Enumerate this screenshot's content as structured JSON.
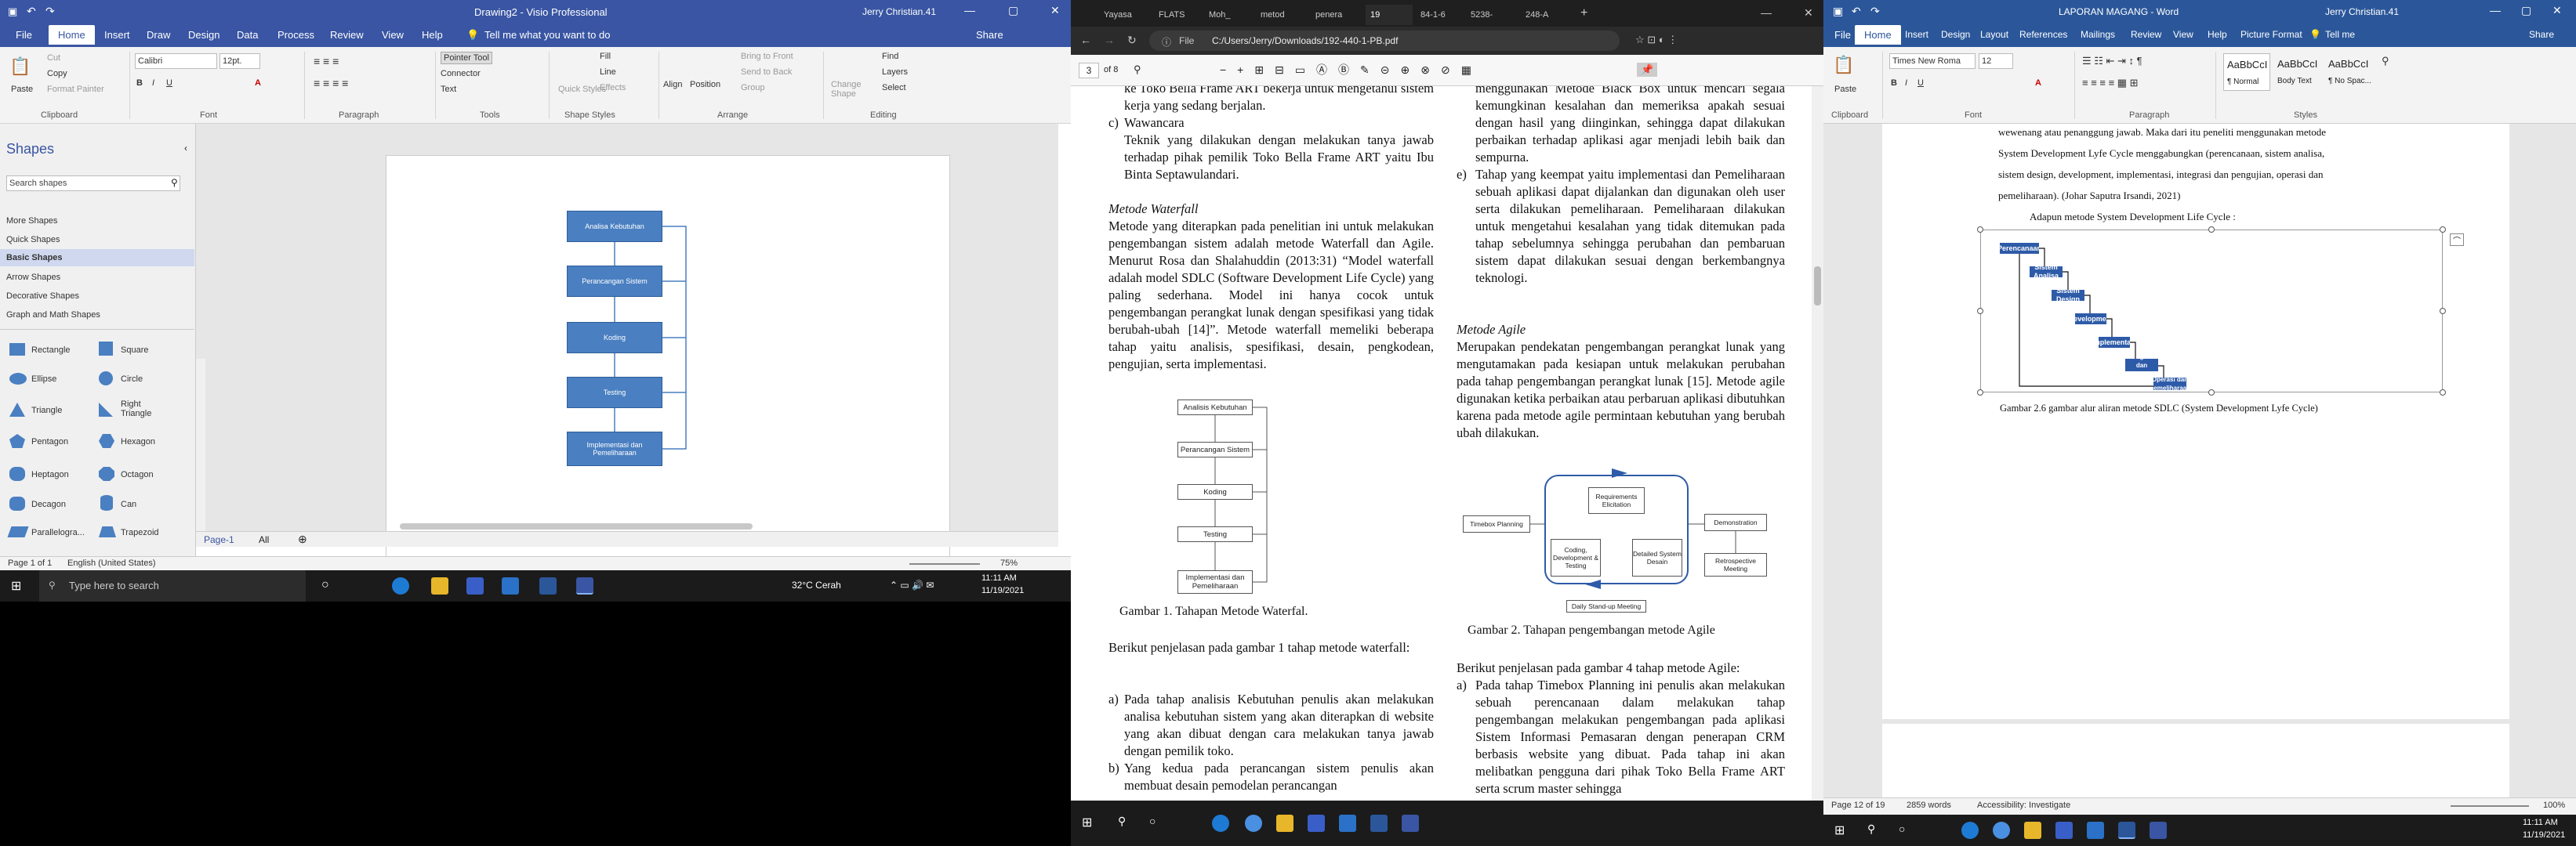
{
  "visio": {
    "title": "Drawing2 - Visio Professional",
    "user": "Jerry Christian.41",
    "tabs": [
      "File",
      "Home",
      "Insert",
      "Draw",
      "Design",
      "Data",
      "Process",
      "Review",
      "View",
      "Help"
    ],
    "tellme": "Tell me what you want to do",
    "share": "Share",
    "ribbon": {
      "clipboard": {
        "paste": "Paste",
        "cut": "Cut",
        "copy": "Copy",
        "format_painter": "Format Painter",
        "label": "Clipboard"
      },
      "font": {
        "name": "Calibri",
        "size": "12pt.",
        "label": "Font"
      },
      "paragraph": {
        "label": "Paragraph"
      },
      "tools": {
        "pointer": "Pointer Tool",
        "connector": "Connector",
        "text": "Text",
        "label": "Tools"
      },
      "shape_styles": {
        "quick": "Quick Styles",
        "fill": "Fill",
        "line": "Line",
        "effects": "Effects",
        "label": "Shape Styles"
      },
      "arrange": {
        "align": "Align",
        "position": "Position",
        "front": "Bring to Front",
        "back": "Send to Back",
        "group": "Group",
        "change": "Change Shape",
        "label": "Arrange"
      },
      "editing": {
        "find": "Find",
        "layers": "Layers",
        "select": "Select",
        "label": "Editing"
      }
    },
    "shapes_panel": {
      "title": "Shapes",
      "search_placeholder": "Search shapes",
      "categories": [
        "More Shapes",
        "Quick Shapes",
        "Basic Shapes",
        "Arrow Shapes",
        "Decorative Shapes",
        "Graph and Math Shapes"
      ],
      "items": [
        "Rectangle",
        "Square",
        "Ellipse",
        "Circle",
        "Triangle",
        "Right Triangle",
        "Pentagon",
        "Hexagon",
        "Heptagon",
        "Octagon",
        "Decagon",
        "Can",
        "Parallelogra...",
        "Trapezoid"
      ]
    },
    "diagram": [
      "Analisa Kebutuhan",
      "Perancangan Sistem",
      "Koding",
      "Testing",
      "Implementasi dan Pemeliharaan"
    ],
    "page_tab": "Page-1",
    "all_tab": "All",
    "status": {
      "page": "Page 1 of 1",
      "language": "English (United States)",
      "zoom": "75%"
    },
    "taskbar": {
      "search": "Type here to search",
      "weather": "32°C  Cerah",
      "time": "11:11 AM",
      "date": "11/19/2021"
    }
  },
  "pdf": {
    "tabs": [
      "Yayasa",
      "FLATS",
      "Moh_",
      "metod",
      "penera",
      "19",
      "84-1-6",
      "5238-",
      "248-A"
    ],
    "address": "C:/Users/Jerry/Downloads/192-440-1-PB.pdf",
    "file_label": "File",
    "page_num": "3",
    "page_of": "of 8",
    "left_col": {
      "p0": "ke Toko Bella Frame ART bekerja untuk mengetahui sistem kerja yang sedang berjalan.",
      "c_label": "c)",
      "c_title": "Wawancara",
      "c_text": "Teknik yang dilakukan dengan melakukan tanya jawab terhadap pihak pemilik Toko Bella Frame ART yaitu Ibu Binta Septawulandari.",
      "h1": "Metode Waterfall",
      "p1": "Metode yang diterapkan pada penelitian ini untuk melakukan pengembangan sistem adalah metode Waterfall dan Agile. Menurut Rosa dan Shalahuddin (2013:31) “Model waterfall adalah model SDLC (Software Development Life Cycle) yang paling sederhana. Model ini hanya cocok untuk pengembangan perangkat lunak dengan spesifikasi yang tidak berubah-ubah [14]”. Metode waterfall memeliki beberapa tahap yaitu analisis, spesifikasi, desain, pengkodean, pengujian, serta implementasi.",
      "fig1_boxes": [
        "Analisis Kebutuhan",
        "Perancangan Sistem",
        "Koding",
        "Testing",
        "Implementasi dan Pemeliharaan"
      ],
      "fig1_caption": "Gambar 1. Tahapan Metode Waterfal.",
      "p2": "Berikut penjelasan pada gambar 1 tahap metode waterfall:",
      "a_label": "a)",
      "a_text": "Pada tahap analisis Kebutuhan penulis akan melakukan analisa kebutuhan sistem yang akan diterapkan di website yang akan dibuat dengan cara melakukan tanya jawab dengan pemilik toko.",
      "b_label": "b)",
      "b_text": "Yang kedua pada perancangan sistem penulis akan membuat desain pemodelan perancangan"
    },
    "right_col": {
      "p0": "menggunakan Metode Black Box untuk mencari segala kemungkinan kesalahan dan memeriksa apakah sesuai dengan hasil yang diinginkan, sehingga dapat dilakukan perbaikan terhadap aplikasi agar menjadi lebih baik dan sempurna.",
      "e_label": "e)",
      "e_text": "Tahap yang keempat yaitu implementasi dan Pemeliharaan sebuah aplikasi dapat dijalankan dan digunakan oleh user serta dilakukan pemeliharaan. Pemeliharaan dilakukan untuk mengetahui kesalahan yang tidak ditemukan pada tahap sebelumnya sehingga perubahan dan pembaruan sistem dapat dilakukan sesuai dengan berkembangnya teknologi.",
      "h1": "Metode Agile",
      "p1": "Merupakan pendekatan pengembangan perangkat lunak yang mengutamakan pada kesiapan untuk melakukan perubahan pada tahap pengembangan perangkat lunak [15]. Metode agile digunakan ketika perbaikan atau perbaruan aplikasi dibutuhkan karena pada metode agile permintaan kebutuhan yang berubah ubah dilakukan.",
      "fig2": {
        "timebox": "Timebox Planning",
        "req": "Requirements Elicitation",
        "coding": "Coding, Development & Testing",
        "design": "Detailed System Desain",
        "demo": "Demonstration",
        "retro": "Retrospective Meeting",
        "standup": "Daily Stand-up Meeting"
      },
      "fig2_caption": "Gambar 2. Tahapan pengembangan metode Agile",
      "p2": "Berikut penjelasan pada gambar 4 tahap metode Agile:",
      "a_label": "a)",
      "a_text": "Pada tahap Timebox Planning ini penulis akan melakukan sebuah perencanaan dalam melakukan tahap pengembangan melakukan pengembangan pada aplikasi Sistem Informasi Pemasaran dengan penerapan CRM berbasis website yang dibuat. Pada tahap ini akan melibatkan pengguna dari pihak Toko Bella Frame ART serta scrum master sehingga"
    }
  },
  "word": {
    "title": "LAPORAN MAGANG - Word",
    "user": "Jerry Christian.41",
    "tabs": [
      "File",
      "Home",
      "Insert",
      "Design",
      "Layout",
      "References",
      "Mailings",
      "Review",
      "View",
      "Help",
      "Picture Format"
    ],
    "tellme": "Tell me",
    "share": "Share",
    "ribbon": {
      "font": "Times New Roma",
      "size": "12",
      "paste": "Paste",
      "clipboard": "Clipboard",
      "font_label": "Font",
      "paragraph": "Paragraph",
      "styles": [
        "AaBbCcI",
        "AaBbCcI",
        "AaBbCcI"
      ],
      "style_names": [
        "¶ Normal",
        "Body Text",
        "¶ No Spac..."
      ],
      "styles_label": "Styles"
    },
    "body": {
      "line1": "wewenang atau penanggung jawab. Maka dari itu peneliti menggunakan metode",
      "line2": "System Development Lyfe Cycle menggabungkan (perencanaan, sistem analisa,",
      "line3": "sistem design, development, implementasi, integrasi dan pengujian, operasi dan",
      "line4": "pemeliharaan). (Johar Saputra Irsandi, 2021)",
      "line5": "Adapun metode System Development Life Cycle :",
      "steps": [
        "Perencanaan",
        "Sistem Analisa",
        "Sistem Design",
        "Development",
        "Implementasi",
        "Integrasi dan Pengujian",
        "Operasi dan Pemeliharaan"
      ],
      "caption": "Gambar 2.6 gambar alur aliran metode SDLC (System Development Lyfe Cycle)"
    },
    "status": {
      "page": "Page 12 of 19",
      "words": "2859 words",
      "access": "Accessibility: Investigate",
      "zoom": "100%"
    },
    "taskbar": {
      "time": "11:11 AM",
      "date": "11/19/2021"
    }
  }
}
